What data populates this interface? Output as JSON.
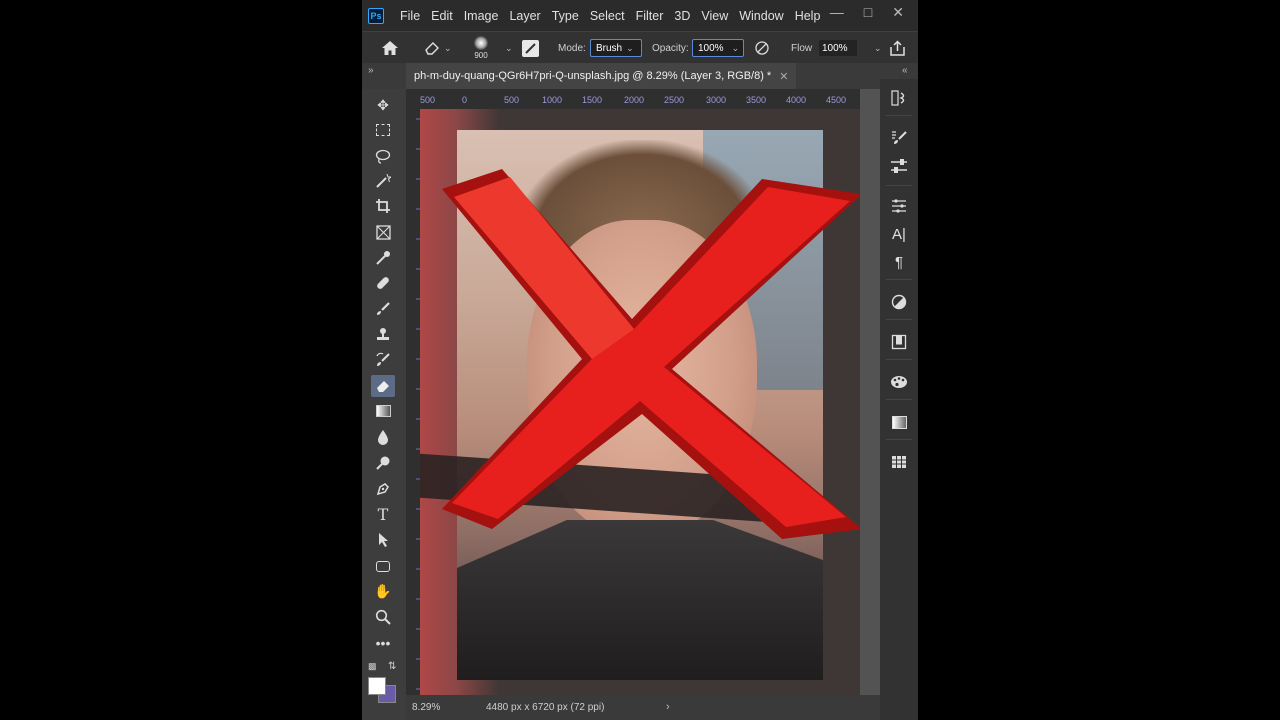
{
  "menu": [
    "File",
    "Edit",
    "Image",
    "Layer",
    "Type",
    "Select",
    "Filter",
    "3D",
    "View",
    "Window",
    "Help"
  ],
  "app_logo": "Ps",
  "options": {
    "brush_size": "900",
    "mode_label": "Mode:",
    "mode_value": "Brush",
    "opacity_label": "Opacity:",
    "opacity_value": "100%",
    "flow_label": "Flow",
    "flow_value": "100%"
  },
  "document": {
    "tab_title": "ph-m-duy-quang-QGr6H7pri-Q-unsplash.jpg @ 8.29% (Layer 3, RGB/8) *"
  },
  "ruler": {
    "h_ticks": [
      "500",
      "0",
      "500",
      "1000",
      "1500",
      "2000",
      "2500",
      "3000",
      "3500",
      "4000",
      "4500"
    ]
  },
  "status": {
    "zoom": "8.29%",
    "doc_size": "4480 px x 6720 px (72 ppi)"
  },
  "colors": {
    "foreground": "#ffffff",
    "background": "#6a5aa8",
    "x_mark": "#e8201d",
    "x_mark_dark": "#a5110f"
  }
}
